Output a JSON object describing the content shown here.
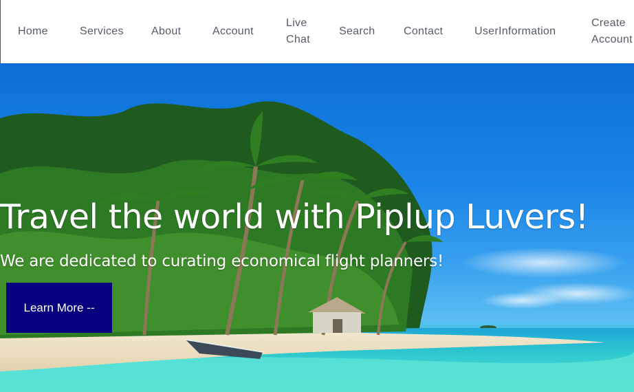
{
  "nav": {
    "items": [
      {
        "label": "Home"
      },
      {
        "label": "Services"
      },
      {
        "label": "About"
      },
      {
        "label": "Account"
      },
      {
        "label": "Live Chat"
      },
      {
        "label": "Search"
      },
      {
        "label": "Contact"
      },
      {
        "label": "UserInformation"
      },
      {
        "label": "Create Account"
      }
    ]
  },
  "hero": {
    "title": "Travel the world with Piplup Luvers!",
    "subtitle": "We are dedicated to curating economical flight planners!",
    "cta_label": "Learn More --",
    "image": "tropical-beach-with-palm-trees-and-boat"
  },
  "colors": {
    "nav_text": "#555c66",
    "cta_background": "#07007f",
    "hero_text": "#ffffff"
  }
}
